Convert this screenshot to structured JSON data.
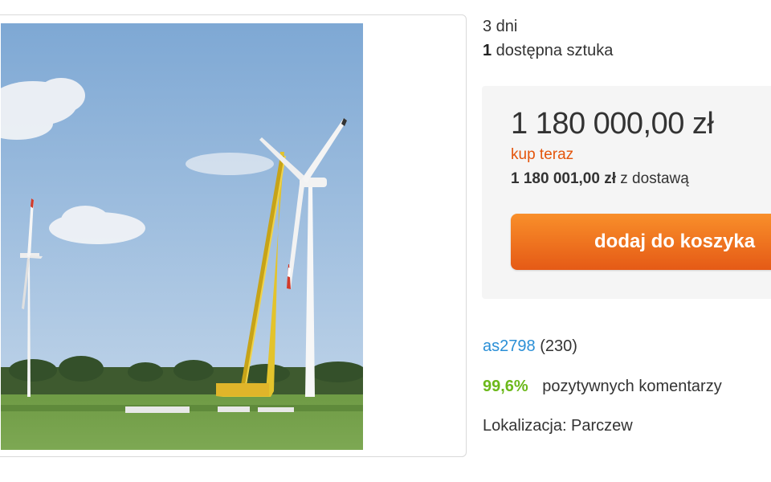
{
  "listing": {
    "time_left": "3 dni",
    "quantity_number": "1",
    "quantity_text": " dostępna sztuka",
    "photo_alt": "wind-turbines-photo"
  },
  "price": {
    "amount": "1 180 000,00 zł",
    "buy_now_label": "kup teraz",
    "with_delivery_amount": "1 180 001,00 zł",
    "with_delivery_text": " z dostawą",
    "add_to_cart_label": "dodaj do koszyka"
  },
  "seller": {
    "name": "as2798",
    "rating_count": "(230)",
    "positive_pct": "99,6%",
    "positive_label": "pozytywnych komentarzy",
    "location": "Lokalizacja: Parczew"
  },
  "colors": {
    "accent_orange": "#e4550c",
    "link_blue": "#2a8fd6",
    "positive_green": "#6cb91b"
  }
}
